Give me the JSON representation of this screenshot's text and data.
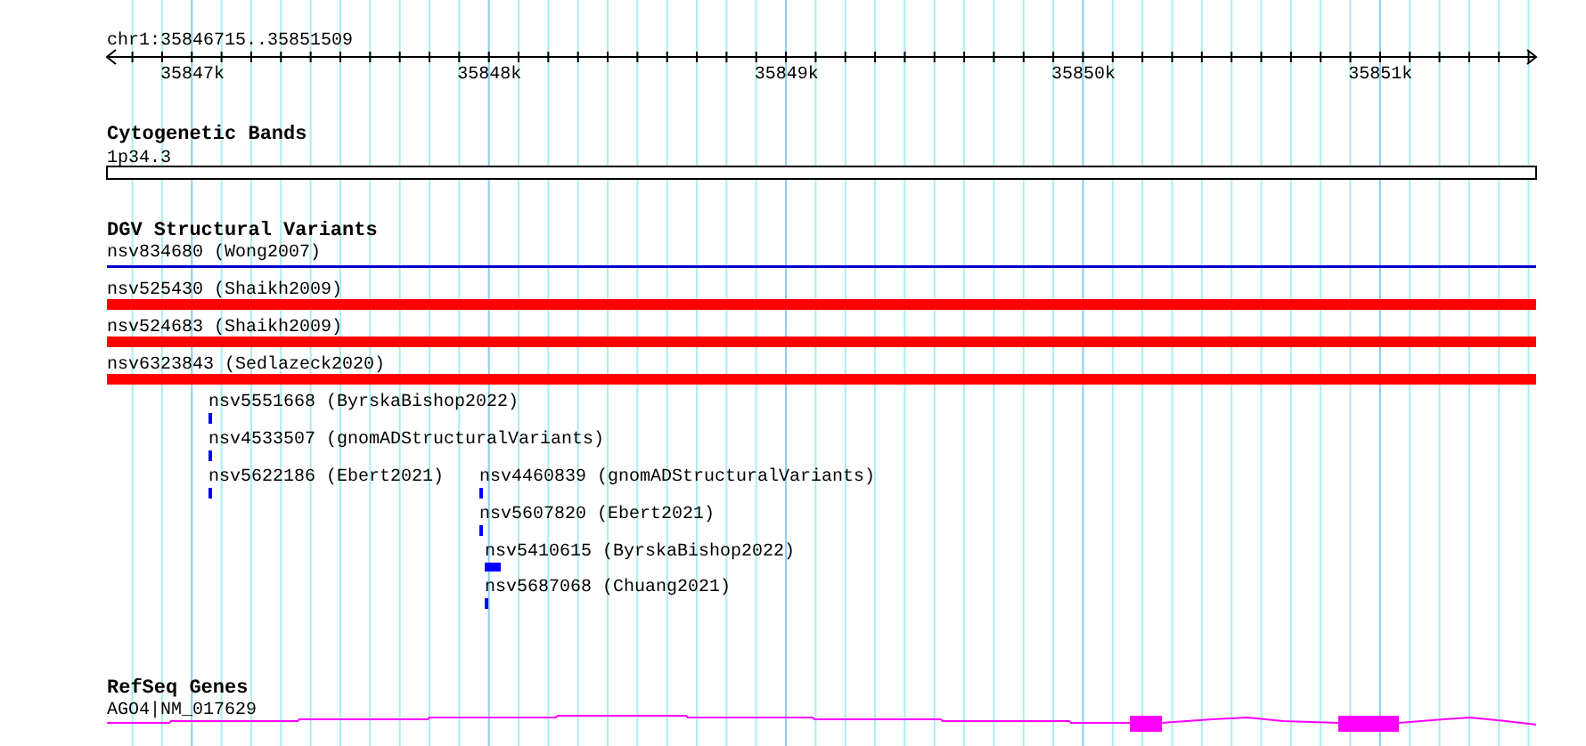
{
  "location": "chr1:35846715..35851509",
  "ruler": {
    "tick_labels": [
      "35847k",
      "35848k",
      "35849k",
      "35850k",
      "35851k"
    ]
  },
  "tracks": [
    {
      "kind": "cytoband",
      "title": "Cytogenetic Bands",
      "features": [
        {
          "label": "1p34.3",
          "kind": "band"
        }
      ]
    },
    {
      "kind": "variants",
      "title": "DGV Structural Variants",
      "features": [
        {
          "label": "nsv834680 (Wong2007)",
          "kind": "line",
          "color": "#0000cc"
        },
        {
          "label": "nsv525430 (Shaikh2009)",
          "kind": "bar",
          "color": "#ff0000"
        },
        {
          "label": "nsv524683 (Shaikh2009)",
          "kind": "bar",
          "color": "#ff0000"
        },
        {
          "label": "nsv6323843 (Sedlazeck2020)",
          "kind": "bar",
          "color": "#ff0000"
        },
        {
          "label": "nsv5551668 (ByrskaBishop2022)",
          "kind": "mark",
          "color": "#0000ff"
        },
        {
          "label": "nsv4533507 (gnomADStructuralVariants)",
          "kind": "mark",
          "color": "#0000ff"
        },
        {
          "label": "nsv5622186 (Ebert2021)",
          "kind": "mark",
          "color": "#0000ff"
        },
        {
          "label": "nsv4460839 (gnomADStructuralVariants)",
          "kind": "mark",
          "color": "#0000ff"
        },
        {
          "label": "nsv5607820 (Ebert2021)",
          "kind": "mark",
          "color": "#0000ff"
        },
        {
          "label": "nsv5410615 (ByrskaBishop2022)",
          "kind": "mark",
          "color": "#0000ff"
        },
        {
          "label": "nsv5687068 (Chuang2021)",
          "kind": "mark",
          "color": "#0000ff"
        }
      ]
    },
    {
      "kind": "genes",
      "title": "RefSeq Genes",
      "features": [
        {
          "label": "AGO4|NM_017629",
          "kind": "gene",
          "color": "#ff00ff"
        }
      ]
    }
  ]
}
